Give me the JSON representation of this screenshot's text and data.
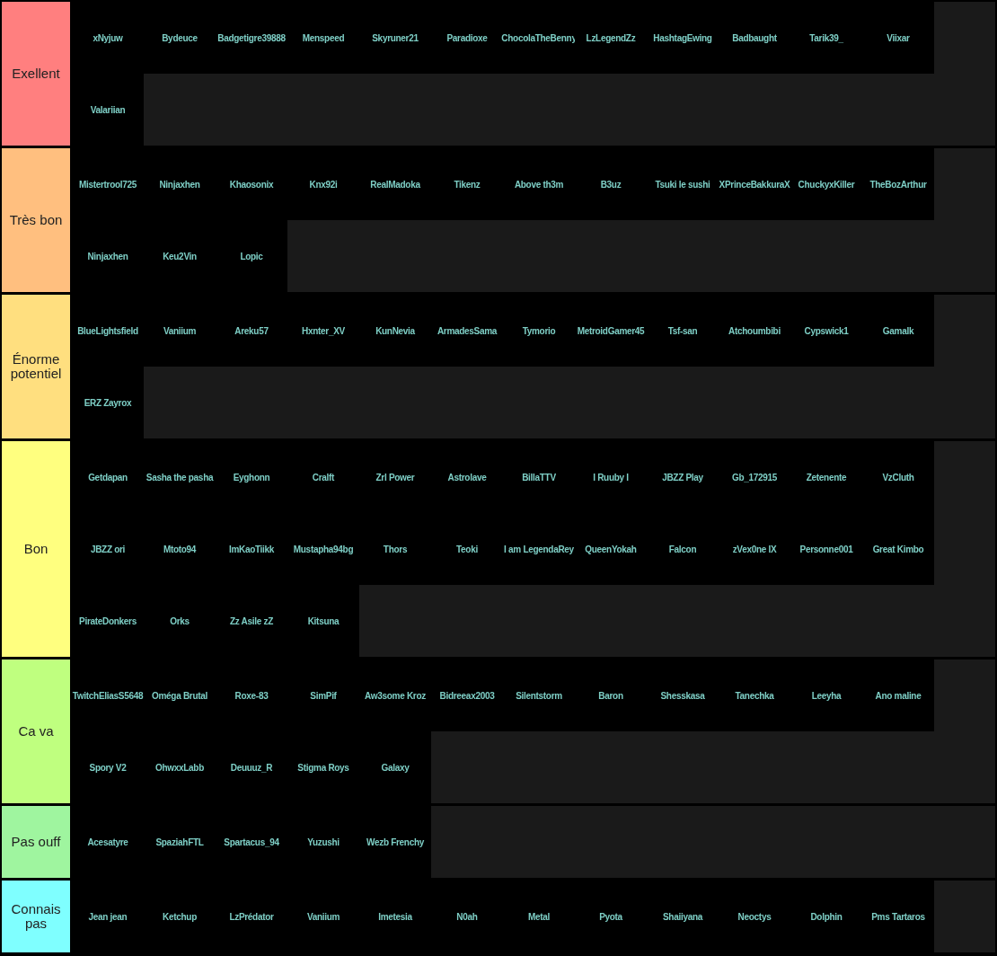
{
  "tiers": [
    {
      "label": "Exellent",
      "color": "#ff7f7f",
      "items": [
        "xNyjuw",
        "Bydeuce",
        "Badgetigre39888",
        "Menspeed",
        "Skyruner21",
        "Paradioxe",
        "ChocolaTheBenny",
        "LzLegendZz",
        "HashtagEwing",
        "Badbaught",
        "Tarik39_",
        "Viixar",
        "Valariian"
      ]
    },
    {
      "label": "Très bon",
      "color": "#ffbf7f",
      "items": [
        "Mistertrool725",
        "Ninjaxhen",
        "Khaosonix",
        "Knx92i",
        "RealMadoka",
        "Tikenz",
        "Above th3m",
        "B3uz",
        "Tsuki le sushi",
        "XPrinceBakkuraX",
        "ChuckyxKiller",
        "TheBozArthur",
        "Ninjaxhen",
        "Keu2Vin",
        "Lopic"
      ]
    },
    {
      "label": "Énorme potentiel",
      "color": "#ffdf7f",
      "items": [
        "BlueLightsfield",
        "Vaniium",
        "Areku57",
        "Hxnter_XV",
        "KunNevia",
        "ArmadesSama",
        "Tymorio",
        "MetroidGamer45",
        "Tsf-san",
        "Atchoumbibi",
        "Cypswick1",
        "Gamalk",
        "ERZ Zayrox"
      ]
    },
    {
      "label": "Bon",
      "color": "#ffff7f",
      "items": [
        "Getdapan",
        "Sasha the pasha",
        "Eyghonn",
        "Cralft",
        "Zrl Power",
        "Astrolave",
        "BillaTTV",
        "I Ruuby I",
        "JBZZ Play",
        "Gb_172915",
        "Zetenente",
        "VzCluth",
        "JBZZ ori",
        "Mtoto94",
        "ImKaoTiikk",
        "Mustapha94bg",
        "Thors",
        "Teoki",
        "I am LegendaRey",
        "QueenYokah",
        "Falcon",
        "zVex0ne IX",
        "Personne001",
        "Great Kimbo",
        "PirateDonkers",
        "Orks",
        "Zz Asile zZ",
        "Kitsuna"
      ]
    },
    {
      "label": "Ca va",
      "color": "#bfff7f",
      "items": [
        "TwitchEliasS5648",
        "Oméga Brutal",
        "Roxe-83",
        "SimPif",
        "Aw3some Kroz",
        "Bidreeax2003",
        "Silentstorm",
        "Baron",
        "Shesskasa",
        "Tanechka",
        "Leeyha",
        "Ano maline",
        "Spory V2",
        "OhwxxLabb",
        "Deuuuz_R",
        "Stigma Roys",
        "Galaxy"
      ]
    },
    {
      "label": "Pas ouff",
      "color": "#9ff59f",
      "items": [
        "Acesatyre",
        "SpaziahFTL",
        "Spartacus_94",
        "Yuzushi",
        "Wezb Frenchy"
      ]
    },
    {
      "label": "Connais pas",
      "color": "#7fffff",
      "items": [
        "Jean jean",
        "Ketchup",
        "LzPrédator",
        "Vaniium",
        "Imetesia",
        "N0ah",
        "Metal",
        "Pyota",
        "Shaiiyana",
        "Neoctys",
        "Dolphin",
        "Pms Tartaros"
      ]
    }
  ]
}
